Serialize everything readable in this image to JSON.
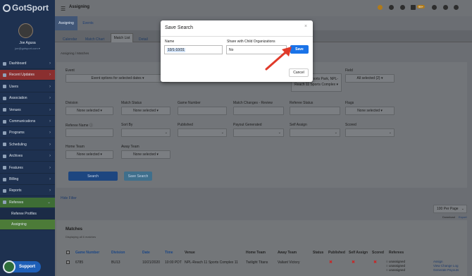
{
  "sidebar": {
    "logo": "GotSport",
    "user_name": "Joe Agusa",
    "user_email": "joe@gotsport.com ▾",
    "items": [
      {
        "label": "Dashboard",
        "style": "normal"
      },
      {
        "label": "Recent Updates",
        "style": "red"
      },
      {
        "label": "Users",
        "style": "normal"
      },
      {
        "label": "Association",
        "style": "normal"
      },
      {
        "label": "Venues",
        "style": "normal"
      },
      {
        "label": "Communications",
        "style": "normal"
      },
      {
        "label": "Programs",
        "style": "normal"
      },
      {
        "label": "Scheduling",
        "style": "normal"
      },
      {
        "label": "Archives",
        "style": "normal"
      },
      {
        "label": "Features",
        "style": "normal"
      },
      {
        "label": "Billing",
        "style": "normal"
      },
      {
        "label": "Reports",
        "style": "normal"
      },
      {
        "label": "Referees",
        "style": "green"
      }
    ],
    "subitems": [
      {
        "label": "Referee Profiles",
        "active": false
      },
      {
        "label": "Assigning",
        "active": true
      }
    ],
    "support": "Support"
  },
  "topbar": {
    "title": "Assigning",
    "badge": "99+"
  },
  "tabs": [
    "Assigning",
    "Events"
  ],
  "subtabs": [
    "Calendar",
    "Match Chart",
    "Match List",
    "Detail"
  ],
  "breadcrumb": "Assigning  /  Matches",
  "filters": {
    "event": {
      "label": "Event",
      "value": "Event options for selected dates ▾"
    },
    "venue_text": "...lth Sports Park, NPL-Reach 11 Sports Complex ▾",
    "field": {
      "label": "Field",
      "value": "All selected (2) ▾"
    },
    "division": {
      "label": "Division",
      "value": "None selected ▾"
    },
    "match_status": {
      "label": "Match Status",
      "value": "None selected ▾"
    },
    "game_number": {
      "label": "Game Number"
    },
    "match_changes": {
      "label": "Match Changes - Review"
    },
    "referee_status": {
      "label": "Referee Status"
    },
    "flags": {
      "label": "Flags",
      "value": "None selected ▾"
    },
    "referee_name": {
      "label": "Referee Name ⓘ"
    },
    "sort_by": {
      "label": "Sort By"
    },
    "published": {
      "label": "Published"
    },
    "payout_generated": {
      "label": "Payout Generated"
    },
    "self_assign": {
      "label": "Self Assign"
    },
    "scored": {
      "label": "Scored"
    },
    "home_team": {
      "label": "Home Team",
      "value": "None selected ▾"
    },
    "away_team": {
      "label": "Away Team",
      "value": "None selected ▾"
    },
    "search_btn": "Search",
    "save_search_btn": "Save Search"
  },
  "hide_filter": "Hide Filter",
  "per_page": "100 Per Page",
  "download": "Download",
  "export": "Export",
  "matches": {
    "title": "Matches",
    "subtitle": "Displaying all 6 matches",
    "columns": [
      "Game Number",
      "Division",
      "Date",
      "Time",
      "Venue",
      "Home Team",
      "Away Team",
      "Status",
      "Published",
      "Self Assign",
      "Scored",
      "Referees"
    ],
    "row": {
      "game_number": "6785",
      "division": "BU13",
      "date": "10/21/2020",
      "time": "10:00 PDT",
      "venue": "NPL-Reach 11 Sports Complex 11",
      "home_team": "Twilight Titans",
      "away_team": "Valiant Victory",
      "referees": [
        "unassigned",
        "unassigned",
        "unassigned"
      ],
      "actions": [
        "Assign",
        "View Change Log",
        "Generate Payouts"
      ]
    }
  },
  "modal": {
    "title": "Save Search",
    "close": "×",
    "name_label": "Name",
    "name_value": "10/1-10/31",
    "share_label": "Share with Child Organizations",
    "share_value": "No",
    "save_btn": "Save",
    "cancel_btn": "Cancel"
  }
}
